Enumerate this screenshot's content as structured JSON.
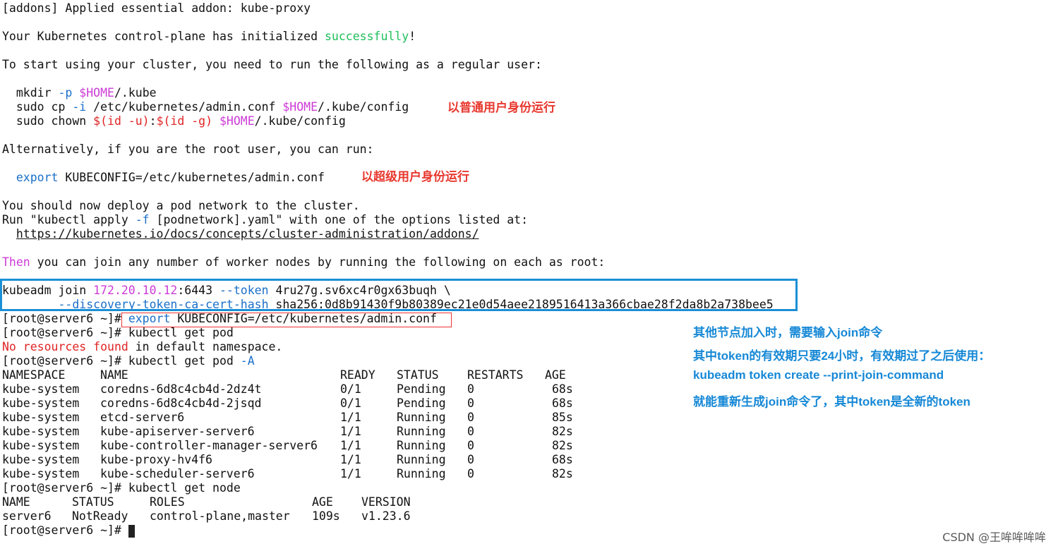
{
  "terminal": {
    "line_addons": "[addons] Applied essential addon: kube-proxy",
    "line_init_pre": "Your Kubernetes control-plane has initialized ",
    "line_init_ok": "successfully",
    "line_init_post": "!",
    "line_start": "To start using your cluster, you need to run the following as a regular user:",
    "cmd_mkdir_a": "  mkdir ",
    "cmd_mkdir_b": "-p ",
    "cmd_mkdir_c": "$HOME",
    "cmd_mkdir_d": "/.kube",
    "cmd_cp_a": "  sudo cp ",
    "cmd_cp_b": "-i",
    "cmd_cp_c": " /etc/kubernetes/admin.conf ",
    "cmd_cp_d": "$HOME",
    "cmd_cp_e": "/.kube/config",
    "cmd_chown_a": "  sudo chown ",
    "cmd_chown_b": "$(id -u)",
    "cmd_chown_c": ":",
    "cmd_chown_d": "$(id -g)",
    "cmd_chown_e": " ",
    "cmd_chown_f": "$HOME",
    "cmd_chown_g": "/.kube/config",
    "line_alt": "Alternatively, if you are the root user, you can run:",
    "cmd_export_a": "  export",
    "cmd_export_b": " KUBECONFIG=/etc/kubernetes/admin.conf",
    "line_deploy": "You should now deploy a pod network to the cluster.",
    "line_run_a": "Run \"kubectl apply ",
    "line_run_b": "-f",
    "line_run_c": " [podnetwork].yaml\" with one of the options listed at:",
    "line_url_pad": "  ",
    "line_url": "https://kubernetes.io/docs/concepts/cluster-administration/addons/",
    "line_then_a": "Then",
    "line_then_b": " you can join any number of worker nodes by running the following on each as root:",
    "join1_a": "kubeadm join ",
    "join1_b": "172.20.10.12",
    "join1_c": ":6443 ",
    "join1_d": "--token",
    "join1_e": " 4ru27g.sv6xc4r0gx63buqh \\",
    "join2_pad": "        ",
    "join2_a": "--discovery-token-ca-cert-hash",
    "join2_b": " sha256:0d8b91430f9b80389ec21e0d54aee2189516413a366cbae28f2da8b2a738bee5",
    "prompt": "[root@server6 ~]# ",
    "p1_a": "export",
    "p1_b": " KUBECONFIG=/etc/kubernetes/admin.conf",
    "p2": "kubectl get pod",
    "nores_a": "No resources ",
    "nores_b": "found",
    "nores_c": " in default namespace.",
    "p3_a": "kubectl get pod ",
    "p3_b": "-A",
    "p4": "kubectl get node"
  },
  "pods_table": {
    "headers": [
      "NAMESPACE",
      "NAME",
      "READY",
      "STATUS",
      "RESTARTS",
      "AGE"
    ],
    "rows": [
      [
        "kube-system",
        "coredns-6d8c4cb4d-2dz4t",
        "0/1",
        "Pending",
        "0",
        "68s"
      ],
      [
        "kube-system",
        "coredns-6d8c4cb4d-2jsqd",
        "0/1",
        "Pending",
        "0",
        "68s"
      ],
      [
        "kube-system",
        "etcd-server6",
        "1/1",
        "Running",
        "0",
        "85s"
      ],
      [
        "kube-system",
        "kube-apiserver-server6",
        "1/1",
        "Running",
        "0",
        "82s"
      ],
      [
        "kube-system",
        "kube-controller-manager-server6",
        "1/1",
        "Running",
        "0",
        "82s"
      ],
      [
        "kube-system",
        "kube-proxy-hv4f6",
        "1/1",
        "Running",
        "0",
        "68s"
      ],
      [
        "kube-system",
        "kube-scheduler-server6",
        "1/1",
        "Running",
        "0",
        "82s"
      ]
    ]
  },
  "nodes_table": {
    "headers": [
      "NAME",
      "STATUS",
      "ROLES",
      "AGE",
      "VERSION"
    ],
    "rows": [
      [
        "server6",
        "NotReady",
        "control-plane,master",
        "109s",
        "v1.23.6"
      ]
    ]
  },
  "annotations": {
    "regular_user": "以普通用户身份运行",
    "super_user": "以超级用户身份运行",
    "note1": "其他节点加入时，需要输入join命令",
    "note2": "其中token的有效期只要24小时，有效期过了之后使用：",
    "note3": "kubeadm token create --print-join-command",
    "note4": "就能重新生成join命令了，其中token是全新的token"
  },
  "watermark": "CSDN @王哞哞哞哞",
  "colors": {
    "success_green": "#1fbf5a",
    "flag_magenta": "#cc3bd6",
    "keyword_blue": "#1a6fc9",
    "error_red": "#e02424",
    "annotation_red": "#e8382e",
    "annotation_blue": "#1688d6",
    "box_blue": "#1a8fd6"
  }
}
